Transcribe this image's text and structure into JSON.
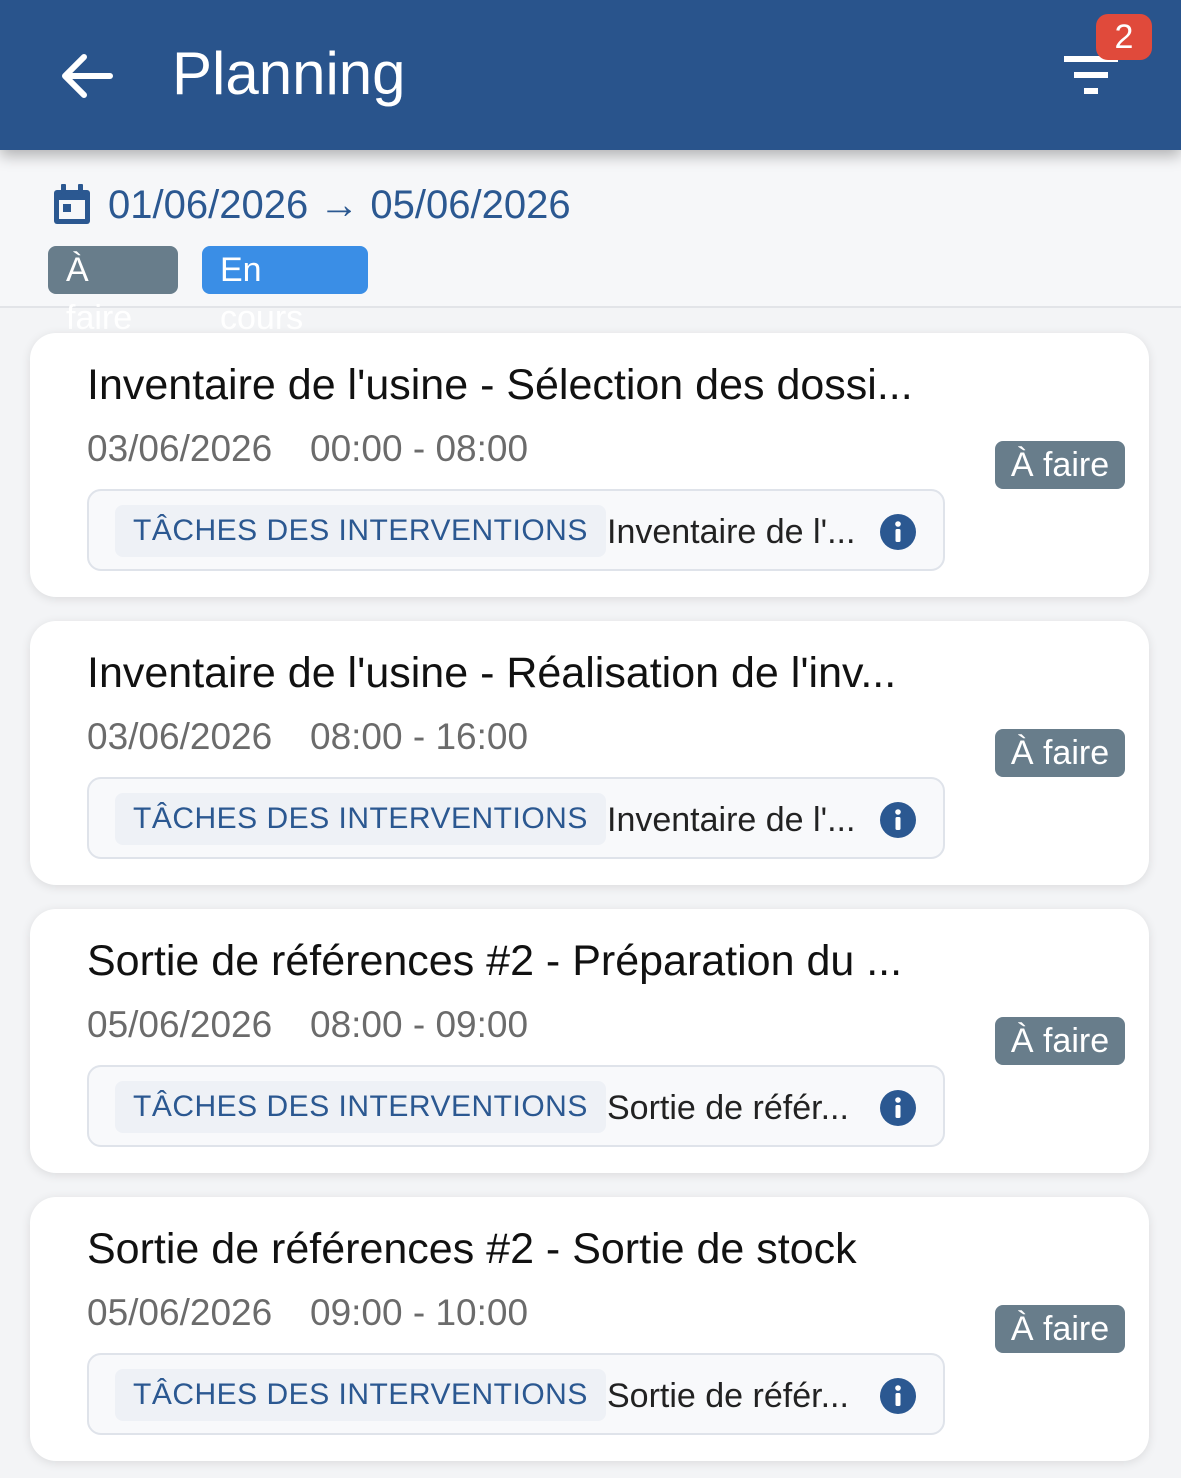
{
  "header": {
    "title": "Planning",
    "back_icon": "arrow-left-icon",
    "filter_icon": "filter-icon",
    "filter_count": "2"
  },
  "summary": {
    "date_range": "01/06/2026 → 05/06/2026",
    "calendar_icon": "calendar-icon",
    "chips": [
      "À faire",
      "En cours"
    ]
  },
  "tasks": [
    {
      "title": "Inventaire de l'usine - Sélection des dossi...",
      "date": "03/06/2026",
      "time": "00:00 - 08:00",
      "category": "TÂCHES DES INTERVENTIONS",
      "reference": "Inventaire de l'...",
      "status": "À faire"
    },
    {
      "title": "Inventaire de l'usine - Réalisation de l'inv...",
      "date": "03/06/2026",
      "time": "08:00 - 16:00",
      "category": "TÂCHES DES INTERVENTIONS",
      "reference": "Inventaire de l'...",
      "status": "À faire"
    },
    {
      "title": "Sortie de références #2 - Préparation du ...",
      "date": "05/06/2026",
      "time": "08:00 - 09:00",
      "category": "TÂCHES DES INTERVENTIONS",
      "reference": "Sortie de référ...",
      "status": "À faire"
    },
    {
      "title": "Sortie de références #2 - Sortie de stock",
      "date": "05/06/2026",
      "time": "09:00 - 10:00",
      "category": "TÂCHES DES INTERVENTIONS",
      "reference": "Sortie de référ...",
      "status": "À faire"
    }
  ],
  "colors": {
    "appbar": "#29548c",
    "accent": "#2b5891",
    "chip_todo": "#687d8b",
    "chip_in_progress": "#3a8ee6",
    "badge": "#e04a3b"
  }
}
